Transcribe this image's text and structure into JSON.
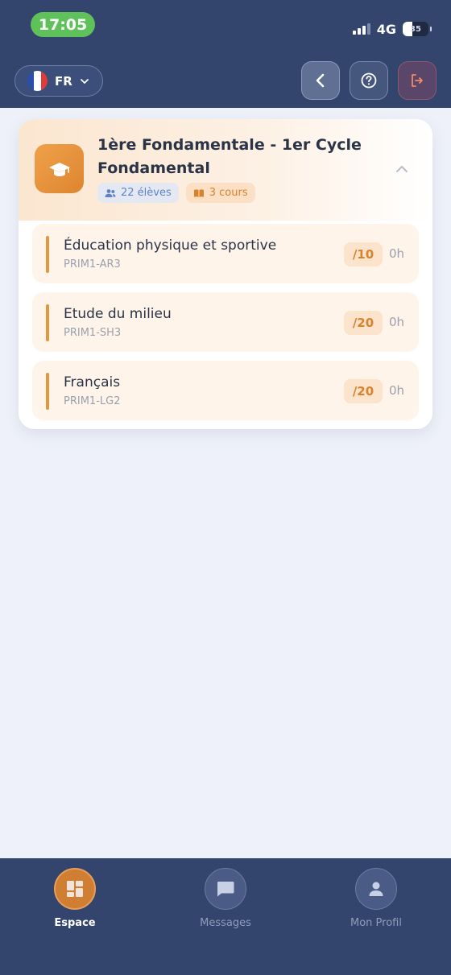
{
  "status_bar": {
    "time": "17:05",
    "network": "4G",
    "battery": "35"
  },
  "header": {
    "language_code": "FR",
    "icons": {
      "flag": "france-flag-icon",
      "back": "chevron-left-icon",
      "help": "help-circle-icon",
      "logout": "logout-icon"
    }
  },
  "class_card": {
    "title": "1ère Fondamentale - 1er Cycle Fondamental",
    "students_badge": "22 élèves",
    "courses_badge": "3 cours",
    "icon": "graduation-cap-icon",
    "courses": [
      {
        "name": "Éducation physique et sportive",
        "code": "PRIM1-AR3",
        "grade": "/10",
        "hours": "0h"
      },
      {
        "name": "Etude du milieu",
        "code": "PRIM1-SH3",
        "grade": "/20",
        "hours": "0h"
      },
      {
        "name": "Français",
        "code": "PRIM1-LG2",
        "grade": "/20",
        "hours": "0h"
      }
    ]
  },
  "bottom_nav": {
    "items": [
      {
        "label": "Espace",
        "icon": "dashboard-icon",
        "active": true
      },
      {
        "label": "Messages",
        "icon": "message-icon",
        "active": false
      },
      {
        "label": "Mon Profil",
        "icon": "user-icon",
        "active": false
      }
    ]
  },
  "colors": {
    "primary": "#33456d",
    "accent": "#d9822e",
    "background": "#eef1f9"
  }
}
